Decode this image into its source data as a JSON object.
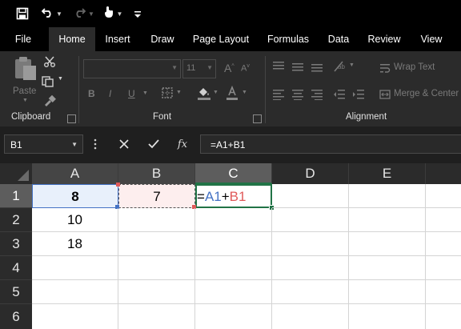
{
  "menu": {
    "tabs": [
      "File",
      "Home",
      "Insert",
      "Draw",
      "Page Layout",
      "Formulas",
      "Data",
      "Review",
      "View"
    ],
    "active": "Home"
  },
  "ribbon": {
    "clipboard": {
      "label": "Clipboard",
      "paste_label": "Paste"
    },
    "font": {
      "label": "Font",
      "size": "11",
      "bold": "B",
      "italic": "I",
      "underline": "U",
      "grow": "A",
      "shrink": "A"
    },
    "alignment": {
      "label": "Alignment",
      "wrap_text": "Wrap Text",
      "merge_center": "Merge & Center"
    }
  },
  "formula_bar": {
    "name_box": "B1",
    "fx": "fx",
    "formula": "=A1+B1"
  },
  "grid": {
    "columns": [
      "A",
      "B",
      "C",
      "D",
      "E"
    ],
    "selected_column": "C",
    "rows": [
      "1",
      "2",
      "3",
      "4",
      "5",
      "6"
    ],
    "selected_row": "1",
    "cells": {
      "A1": "8",
      "B1": "7",
      "C1_eq": "=",
      "C1_ref1": "A1",
      "C1_plus": "+",
      "C1_ref2": "B1",
      "A2": "10",
      "A3": "18"
    }
  },
  "colors": {
    "ref_a1": "#4472c4",
    "ref_b1": "#e05a5a",
    "ref_a1_fill": "#e8f0fb",
    "ref_b1_fill": "#fdeeee",
    "active_border": "#217346",
    "chrome_bg": "#2b2b2b"
  }
}
